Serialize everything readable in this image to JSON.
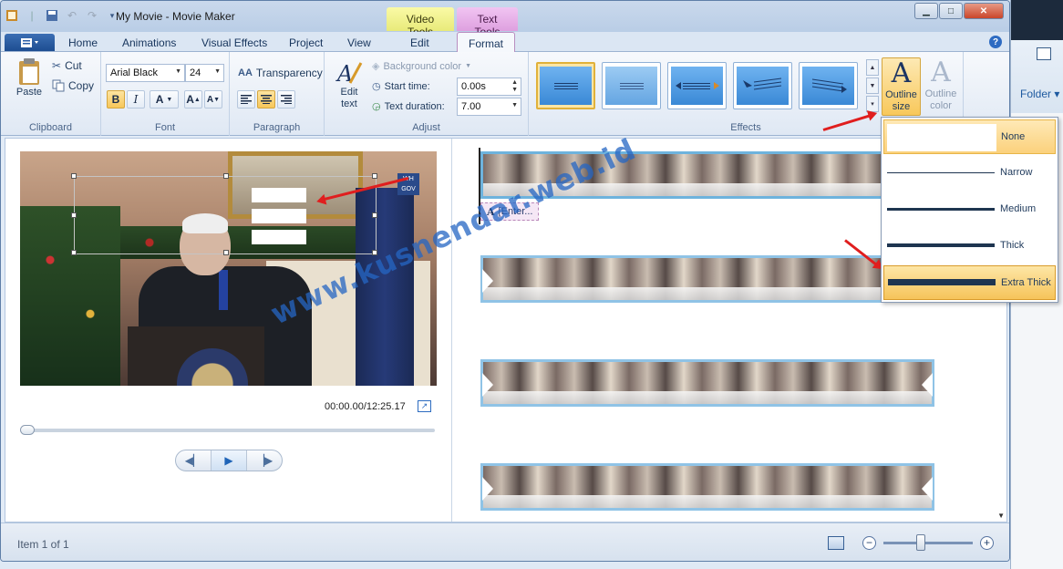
{
  "window": {
    "title": "My Movie - Movie Maker",
    "minimize_glyph": "▁",
    "maximize_glyph": "□",
    "close_glyph": "✕"
  },
  "context_tabs": {
    "video_tools": "Video Tools",
    "text_tools": "Text Tools"
  },
  "tabs": [
    "Home",
    "Animations",
    "Visual Effects",
    "Project",
    "View",
    "Edit",
    "Format"
  ],
  "active_tab": "Format",
  "groups": {
    "clipboard": {
      "label": "Clipboard",
      "paste": "Paste",
      "cut": "Cut",
      "copy": "Copy"
    },
    "font": {
      "label": "Font",
      "family": "Arial Black",
      "size": "24",
      "bold": "B",
      "italic": "I",
      "color": "A",
      "grow": "A",
      "shrink": "A"
    },
    "paragraph": {
      "label": "Paragraph",
      "transparency": "Transparency"
    },
    "adjust": {
      "label": "Adjust",
      "edit_text": "Edit text",
      "background_color": "Background color",
      "start_time_label": "Start time:",
      "start_time_value": "0.00s",
      "text_duration_label": "Text duration:",
      "text_duration_value": "7.00"
    },
    "effects": {
      "label": "Effects",
      "outline_size": "Outline size",
      "outline_color": "Outline color"
    }
  },
  "preview": {
    "timecode": "00:00.00/12:25.17",
    "seek_position": 0
  },
  "storyboard": {
    "caption": "[Enter..."
  },
  "outline_menu": {
    "items": [
      {
        "label": "None",
        "state": "hover"
      },
      {
        "label": "Narrow",
        "state": "normal"
      },
      {
        "label": "Medium",
        "state": "normal"
      },
      {
        "label": "Thick",
        "state": "normal"
      },
      {
        "label": "Extra Thick",
        "state": "selected"
      }
    ]
  },
  "status": {
    "item_text": "Item 1 of 1"
  },
  "background_window": {
    "folder_label": "Folder"
  },
  "video_overlay": {
    "badge_text": "WH GOV"
  },
  "watermark": "www.kusnendar.web.id",
  "colors": {
    "accent": "#2e6bc2",
    "selection": "#f6c45a",
    "arrow": "#e01e1e",
    "text_tools_tab": "#dea0df",
    "video_tools_tab": "#e8ea7a"
  }
}
